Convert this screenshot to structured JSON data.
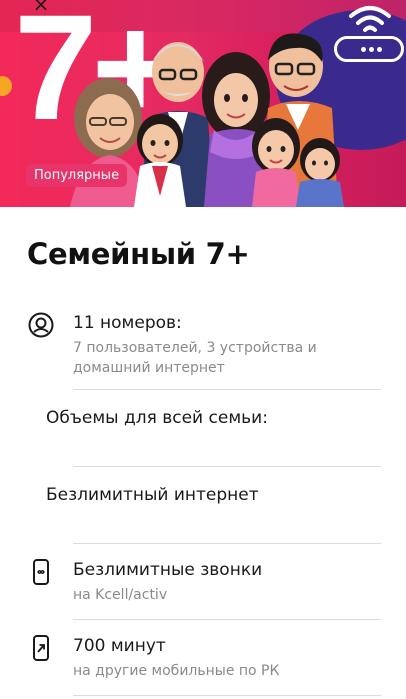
{
  "hero": {
    "plan_number": "7+",
    "badge": "Популярные",
    "close_glyph": "×",
    "colors": {
      "banner": "#e42a62",
      "accent_blob": "#3b2a8d",
      "badge": "#e8346a"
    },
    "icons": [
      "close-icon",
      "wifi-icon",
      "router-icon"
    ]
  },
  "plan": {
    "title": "Семейный 7+"
  },
  "features": [
    {
      "icon": "person-circle-icon",
      "title": "11 номеров:",
      "subtitle_line1": "7 пользователей, 3 устройства и",
      "subtitle_line2": "домашний интернет"
    },
    {
      "icon": "infinity-phone-icon",
      "title": "Безлимитные звонки",
      "subtitle": "на Kcell/activ"
    },
    {
      "icon": "outgoing-call-phone-icon",
      "title": "700 минут",
      "subtitle": "на другие мобильные по РК"
    }
  ],
  "sections": {
    "family_volumes": "Объемы для всей семьи:",
    "unlimited_internet": "Безлимитный интернет"
  }
}
